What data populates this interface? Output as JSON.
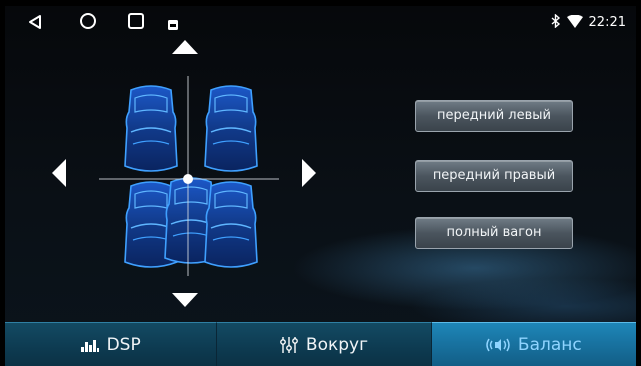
{
  "status_bar": {
    "time": "22:21",
    "icons": [
      "back-icon",
      "home-icon",
      "recents-icon",
      "screenshot-icon",
      "bluetooth-icon",
      "wifi-icon"
    ]
  },
  "balance_zones": [
    {
      "label": "передний левый"
    },
    {
      "label": "передний правый"
    },
    {
      "label": "полный вагон"
    }
  ],
  "tabs": [
    {
      "label": "DSP",
      "icon": "equalizer-icon"
    },
    {
      "label": "Вокруг",
      "icon": "sliders-icon"
    },
    {
      "label": "Баланс",
      "icon": "speaker-icon",
      "active": true
    }
  ],
  "colors": {
    "accent": "#1e86b8",
    "seat_glow": "#2f8fff",
    "active_tab_text": "#8fd4ff"
  }
}
